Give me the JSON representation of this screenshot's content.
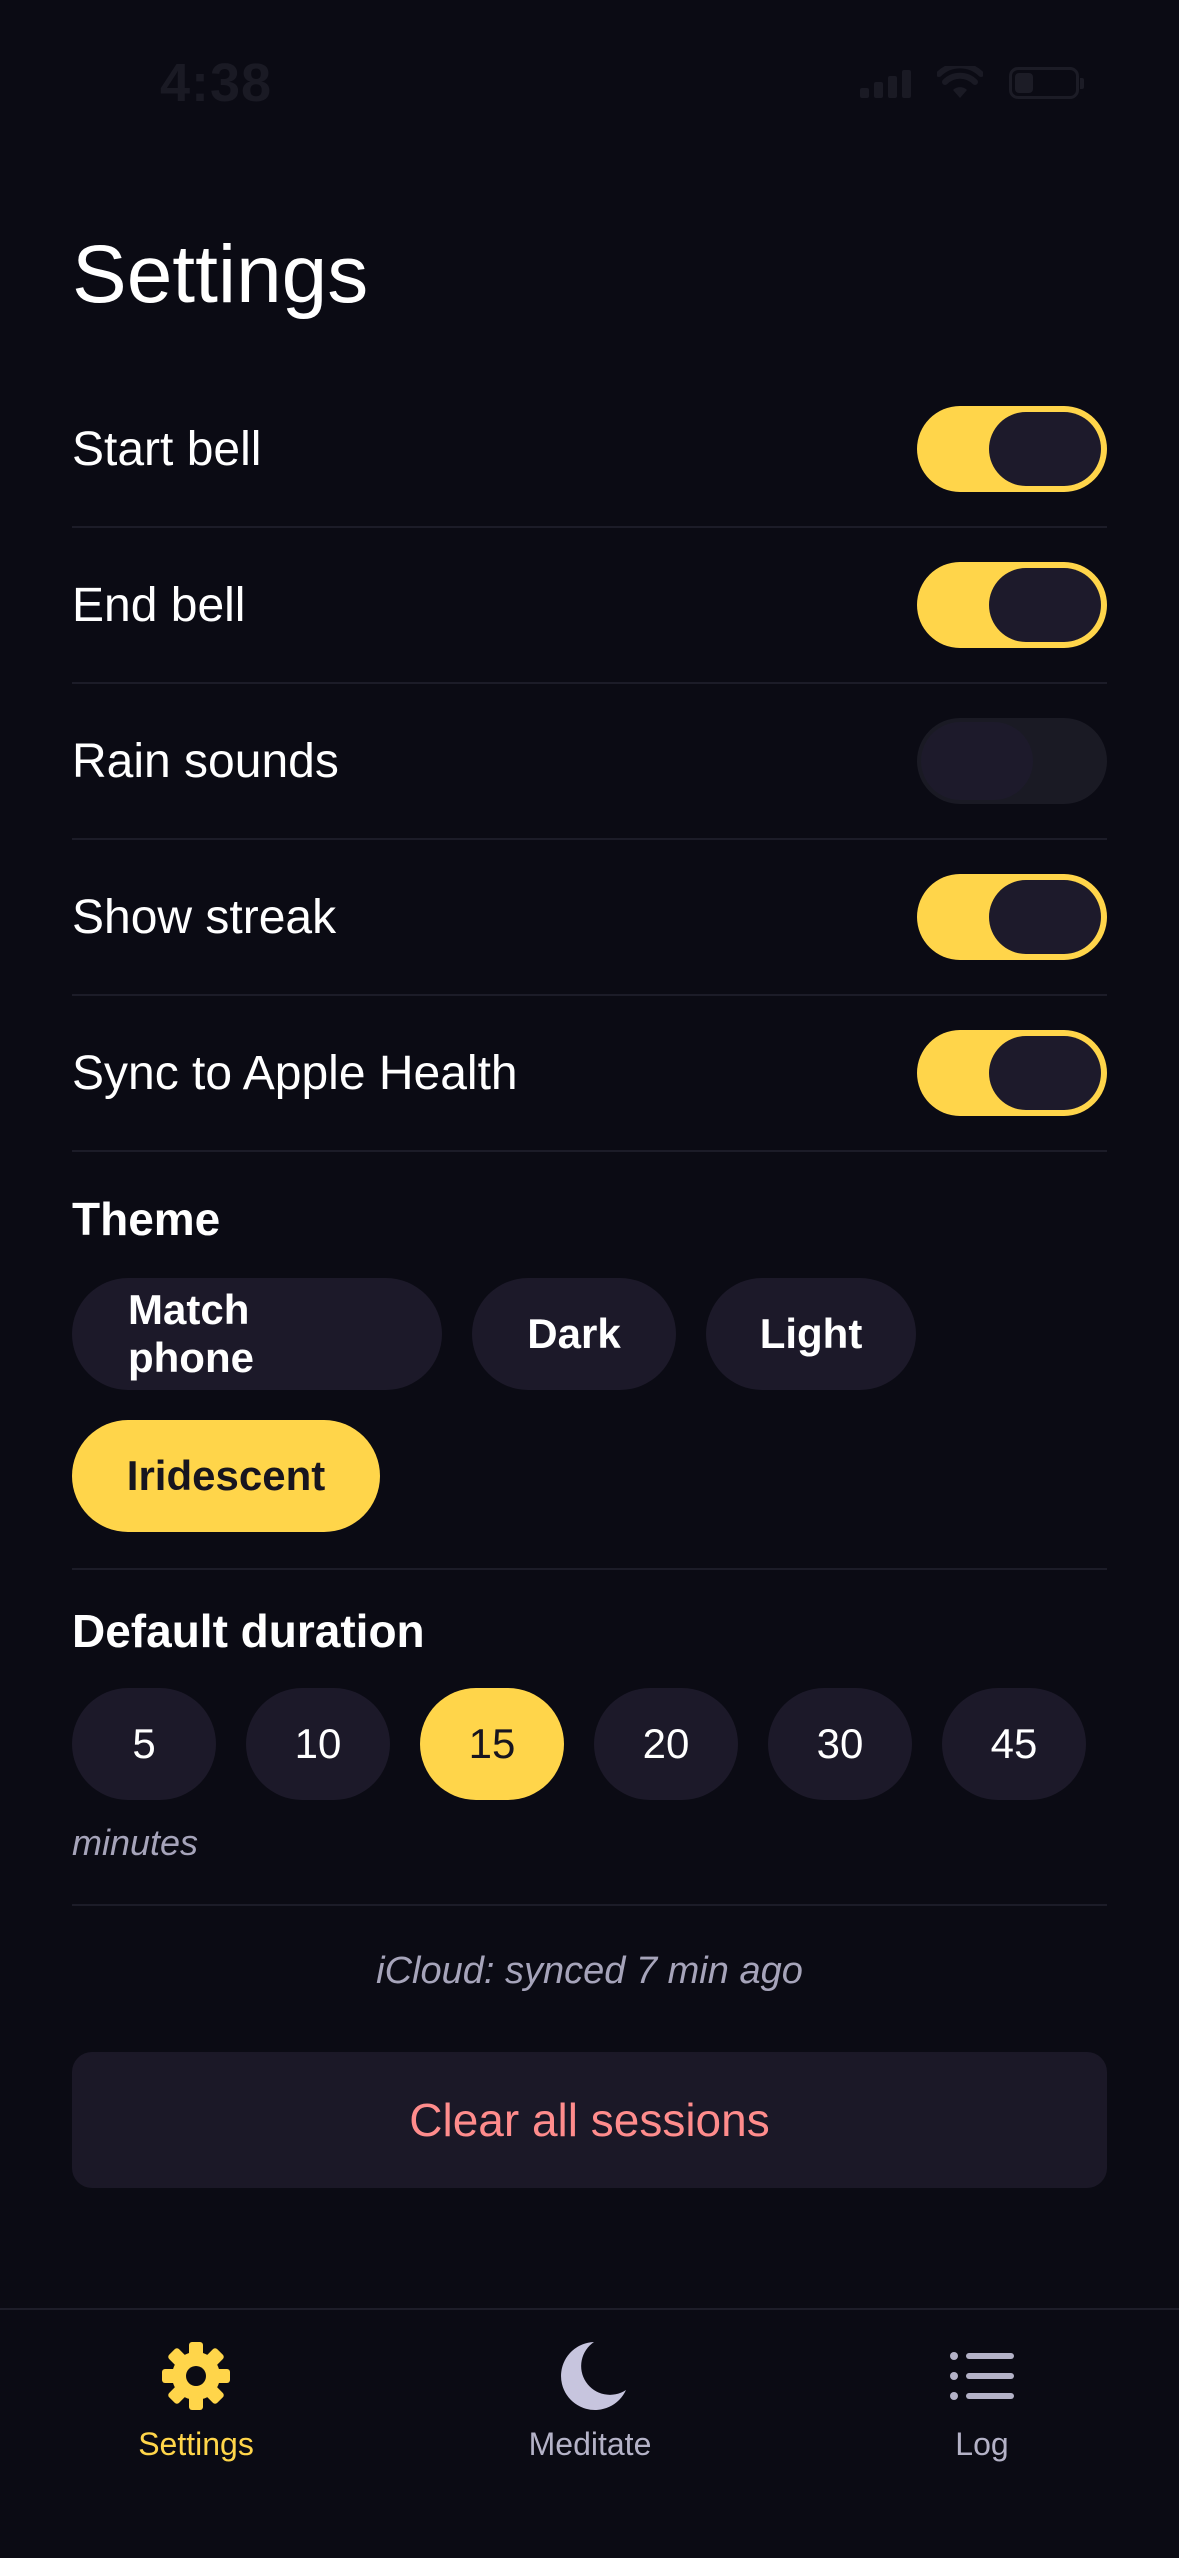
{
  "status_bar": {
    "time": "4:38"
  },
  "page": {
    "title": "Settings"
  },
  "toggles": [
    {
      "label": "Start bell",
      "on": true
    },
    {
      "label": "End bell",
      "on": true
    },
    {
      "label": "Rain sounds",
      "on": false
    },
    {
      "label": "Show streak",
      "on": true
    },
    {
      "label": "Sync to Apple Health",
      "on": true
    }
  ],
  "theme": {
    "title": "Theme",
    "options": [
      "Match phone",
      "Dark",
      "Light",
      "Iridescent"
    ],
    "selected": "Iridescent"
  },
  "duration": {
    "title": "Default duration",
    "options": [
      "5",
      "10",
      "15",
      "20",
      "30",
      "45"
    ],
    "selected": "15",
    "unit_label": "minutes"
  },
  "sync_status": "iCloud: synced 7 min ago",
  "clear_button_label": "Clear all sessions",
  "tab_bar": {
    "tabs": [
      {
        "label": "Settings",
        "icon": "gear-icon",
        "active": true
      },
      {
        "label": "Meditate",
        "icon": "moon-icon",
        "active": false
      },
      {
        "label": "Log",
        "icon": "list-icon",
        "active": false
      }
    ]
  },
  "colors": {
    "background": "#0b0b14",
    "accent": "#ffd54a",
    "chip_bg": "#1c1929",
    "danger_text": "#ff8c8c",
    "muted_text": "#a6a4ba"
  }
}
